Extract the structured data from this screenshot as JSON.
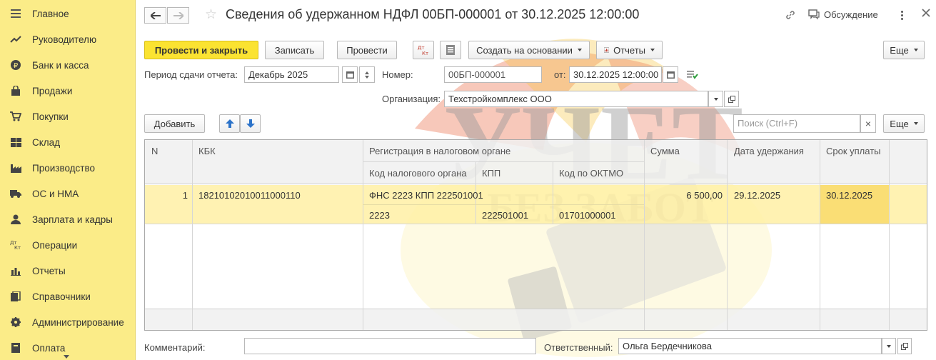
{
  "sidebar": {
    "items": [
      {
        "label": "Главное",
        "icon": "menu-icon"
      },
      {
        "label": "Руководителю",
        "icon": "trend-icon"
      },
      {
        "label": "Банк и касса",
        "icon": "ruble-coin-icon"
      },
      {
        "label": "Продажи",
        "icon": "shopping-bag-icon"
      },
      {
        "label": "Покупки",
        "icon": "cart-icon"
      },
      {
        "label": "Склад",
        "icon": "warehouse-icon"
      },
      {
        "label": "Производство",
        "icon": "factory-icon"
      },
      {
        "label": "ОС и НМА",
        "icon": "truck-icon"
      },
      {
        "label": "Зарплата и кадры",
        "icon": "person-icon"
      },
      {
        "label": "Операции",
        "icon": "dt-kt-icon"
      },
      {
        "label": "Отчеты",
        "icon": "bar-chart-icon"
      },
      {
        "label": "Справочники",
        "icon": "books-icon"
      },
      {
        "label": "Администрирование",
        "icon": "gear-icon"
      },
      {
        "label": "Оплата",
        "icon": "payment-icon"
      }
    ]
  },
  "header": {
    "title": "Сведения об удержанном НДФЛ 00БП-000001 от 30.12.2025 12:00:00",
    "discussion": "Обсуждение"
  },
  "toolbar": {
    "post_close": "Провести и закрыть",
    "save": "Записать",
    "post": "Провести",
    "dt_kt": "ДтКт",
    "create_based": "Создать на основании",
    "reports": "Отчеты",
    "more": "Еще"
  },
  "form": {
    "period_label": "Период сдачи отчета:",
    "period_value": "Декабрь 2025",
    "number_label": "Номер:",
    "number_value": "00БП-000001",
    "date_label": "от:",
    "date_value": "30.12.2025 12:00:00",
    "org_label": "Организация:",
    "org_value": "Техстройкомплекс ООО"
  },
  "table_toolbar": {
    "add": "Добавить",
    "search_placeholder": "Поиск (Ctrl+F)",
    "clear": "×",
    "more": "Еще"
  },
  "table": {
    "headers": {
      "n": "N",
      "kbk": "КБК",
      "registration": "Регистрация в налоговом органе",
      "tax_code": "Код налогового органа",
      "kpp": "КПП",
      "oktmo": "Код по ОКТМО",
      "sum": "Сумма",
      "withhold_date": "Дата удержания",
      "due_date": "Срок уплаты"
    },
    "rows": [
      {
        "n": "1",
        "kbk": "18210102010011000110",
        "registration": "ФНС 2223 КПП 222501001",
        "tax_code": "2223",
        "kpp": "222501001",
        "oktmo": "01701000001",
        "sum": "6 500,00",
        "withhold_date": "29.12.2025",
        "due_date": "30.12.2025"
      }
    ]
  },
  "bottom": {
    "comment_label": "Комментарий:",
    "comment_value": "",
    "responsible_label": "Ответственный:",
    "responsible_value": "Ольга Бердечникова"
  },
  "watermark": {
    "line1": "УЧЕТ",
    "line2": "БЕЗ ЗАБОТ"
  }
}
